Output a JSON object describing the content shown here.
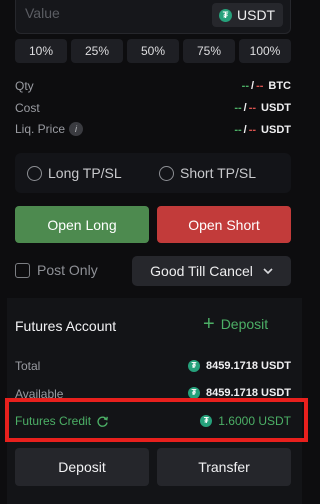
{
  "order_input": {
    "value_placeholder": "Value",
    "coin": "USDT",
    "coin_icon": "tether-icon"
  },
  "percent_buttons": [
    "10%",
    "25%",
    "50%",
    "75%",
    "100%"
  ],
  "info": {
    "qty": {
      "label": "Qty",
      "long": "--",
      "sep": "/",
      "short": "--",
      "unit": "BTC"
    },
    "cost": {
      "label": "Cost",
      "long": "--",
      "sep": "/",
      "short": "--",
      "unit": "USDT"
    },
    "liq": {
      "label": "Liq. Price",
      "info_glyph": "i",
      "long": "--",
      "sep": "/",
      "short": "--",
      "unit": "USDT"
    }
  },
  "tpsl": {
    "long_label": "Long TP/SL",
    "short_label": "Short TP/SL"
  },
  "actions": {
    "open_long": "Open Long",
    "open_short": "Open Short"
  },
  "post_only_label": "Post Only",
  "time_in_force": {
    "selected": "Good Till Cancel"
  },
  "futures_account": {
    "title": "Futures Account",
    "deposit_link": "Deposit",
    "total_label": "Total",
    "total_value": "8459.1718 USDT",
    "available_label": "Available",
    "available_value": "8459.1718 USDT",
    "credit_label": "Futures Credit",
    "credit_value": "1.6000 USDT"
  },
  "bottom_buttons": {
    "deposit": "Deposit",
    "transfer": "Transfer"
  },
  "colors": {
    "background": "#0d0d0f",
    "long_green": "#4d8a4f",
    "short_red": "#c23b3a",
    "accent_green": "#4caf66",
    "highlight_red": "#e8201d"
  }
}
